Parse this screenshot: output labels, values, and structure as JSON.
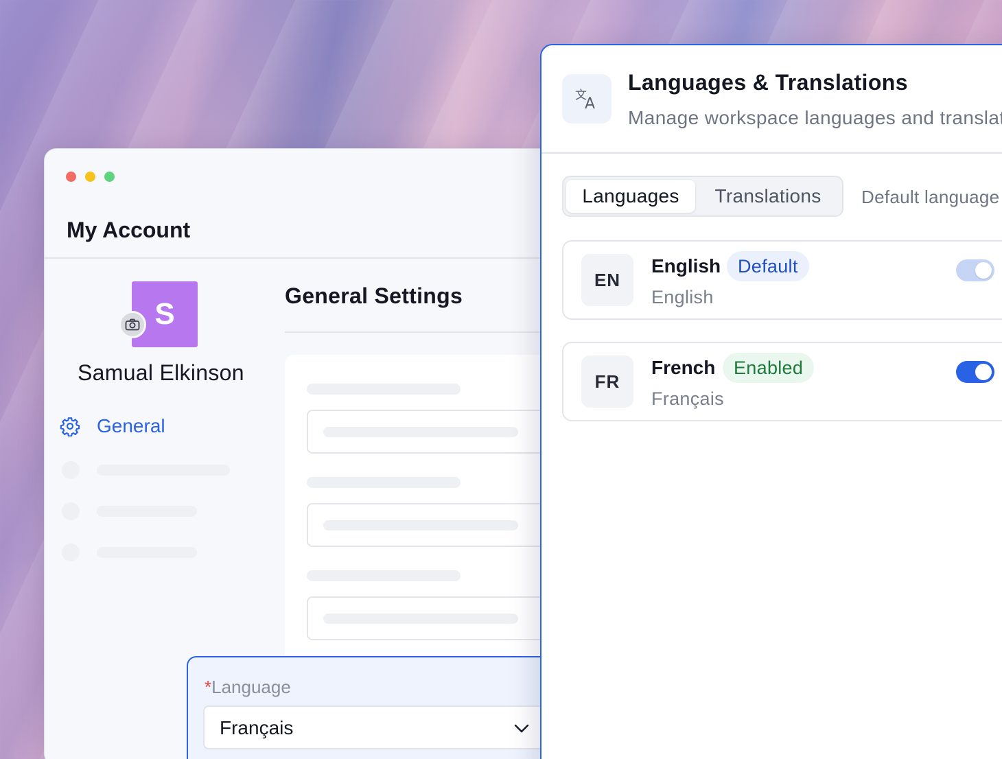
{
  "account_window": {
    "title": "My Account",
    "avatar_initial": "S",
    "user_name": "Samual Elkinson",
    "nav": {
      "general_label": "General"
    },
    "section_title": "General Settings"
  },
  "language_field": {
    "required_mark": "*",
    "label": "Language",
    "selected_value": "Français"
  },
  "panel": {
    "title": "Languages & Translations",
    "subtitle": "Manage workspace languages and translations",
    "tabs": [
      {
        "label": "Languages",
        "active": true
      },
      {
        "label": "Translations",
        "active": false
      }
    ],
    "default_language_label": "Default language",
    "languages": [
      {
        "code": "EN",
        "name": "English",
        "native": "English",
        "badge": "Default",
        "toggle_on": true,
        "toggle_disabled": true
      },
      {
        "code": "FR",
        "name": "French",
        "native": "Français",
        "badge": "Enabled",
        "toggle_on": true,
        "toggle_disabled": false
      }
    ]
  },
  "colors": {
    "accent": "#2a62e6",
    "avatar_bg": "#b777ee",
    "badge_default_text": "#1f4fc4",
    "badge_enabled_text": "#1c7a3b"
  },
  "icons": [
    "camera-icon",
    "gear-icon",
    "chevron-down-icon",
    "translate-icon"
  ]
}
